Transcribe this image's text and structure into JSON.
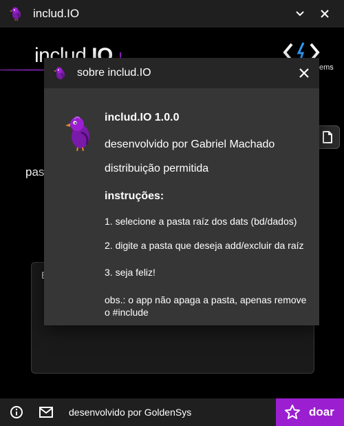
{
  "window": {
    "title": "includ.IO"
  },
  "main": {
    "brand_light": "includ.",
    "brand_bold": "IO",
    "company_text": "ems",
    "path_label": "pas",
    "list_text": "E"
  },
  "dialog": {
    "title": "sobre includ.IO",
    "app_name": "includ.IO 1.0.0",
    "developer": "desenvolvido por Gabriel Machado",
    "distribution": "distribuição permitida",
    "instructions_heading": "instruções:",
    "steps": [
      "1. selecione a pasta raíz dos dats (bd/dados)",
      "2. digite a pasta que deseja add/excluir da raíz",
      "3. seja feliz!"
    ],
    "note": "obs.: o app não apaga a pasta, apenas remove o #include"
  },
  "footer": {
    "developer_text": "desenvolvido por GoldenSys",
    "donate_label": "doar"
  },
  "colors": {
    "accent": "#9b1fd0",
    "titlebar": "#1f1f1f",
    "dialog_bg": "#363636",
    "dialog_header": "#262626"
  },
  "icons": {
    "app": "bird-icon",
    "minimize": "chevron-down-icon",
    "close": "close-icon",
    "file": "file-icon",
    "info": "info-icon",
    "mail": "mail-icon",
    "donate": "star-icon",
    "company": "code-brackets-icon"
  }
}
